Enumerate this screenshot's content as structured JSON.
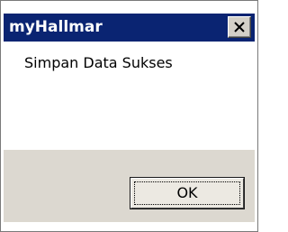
{
  "window": {
    "title": "myHallmar",
    "close_icon": "close-icon"
  },
  "message": {
    "text": "Simpan Data Sukses"
  },
  "buttons": {
    "ok_label": "OK"
  },
  "colors": {
    "title_bar": "#0a2472",
    "title_text": "#ffffff",
    "button_area": "#dcd8d0",
    "button_face": "#ece9e2"
  }
}
